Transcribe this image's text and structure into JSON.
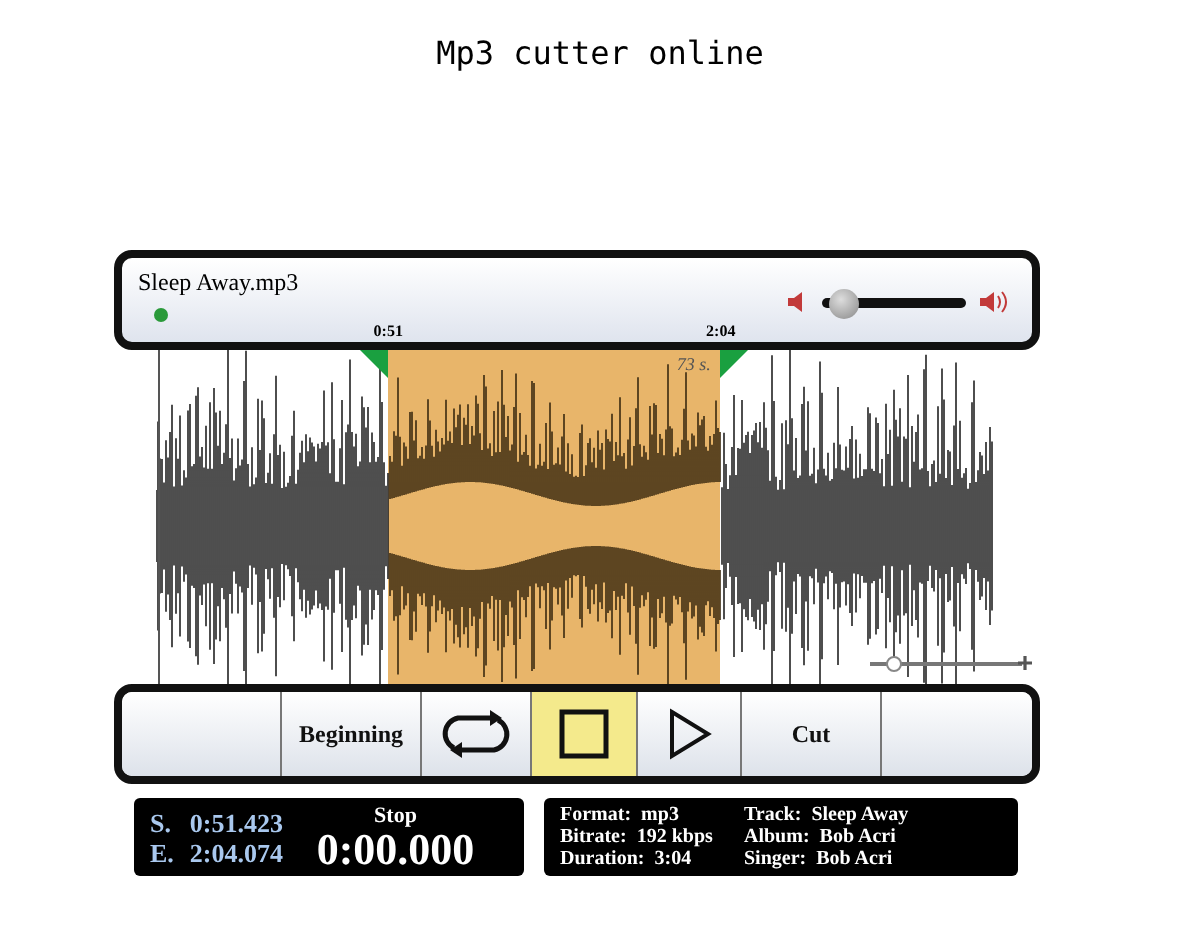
{
  "page_title": "Mp3 cutter online",
  "file": {
    "name": "Sleep Away.mp3",
    "volume": {
      "level": 0.15
    }
  },
  "selection": {
    "start_label": "0:51",
    "end_label": "2:04",
    "length_label": "73 s."
  },
  "zoom": {
    "level": 0.12
  },
  "toolbar": [
    {
      "kind": "blank",
      "selected": false
    },
    {
      "kind": "text",
      "label": "Beginning",
      "selected": false
    },
    {
      "kind": "loop",
      "selected": false
    },
    {
      "kind": "stop",
      "selected": true
    },
    {
      "kind": "play",
      "selected": false
    },
    {
      "kind": "text",
      "label": "Cut",
      "selected": false
    },
    {
      "kind": "blank",
      "selected": false
    }
  ],
  "times": {
    "start_prefix": "S.",
    "start": "0:51.423",
    "end_prefix": "E.",
    "end": "2:04.074",
    "state": "Stop",
    "position": "0:00.000"
  },
  "info": [
    {
      "label": "Format:",
      "value": "mp3"
    },
    {
      "label": "Bitrate:",
      "value": "192 kbps"
    },
    {
      "label": "Duration:",
      "value": "3:04"
    },
    {
      "label": "Track:",
      "value": "Sleep Away"
    },
    {
      "label": "Album:",
      "value": "Bob Acri"
    },
    {
      "label": "Singer:",
      "value": "Bob Acri"
    }
  ]
}
